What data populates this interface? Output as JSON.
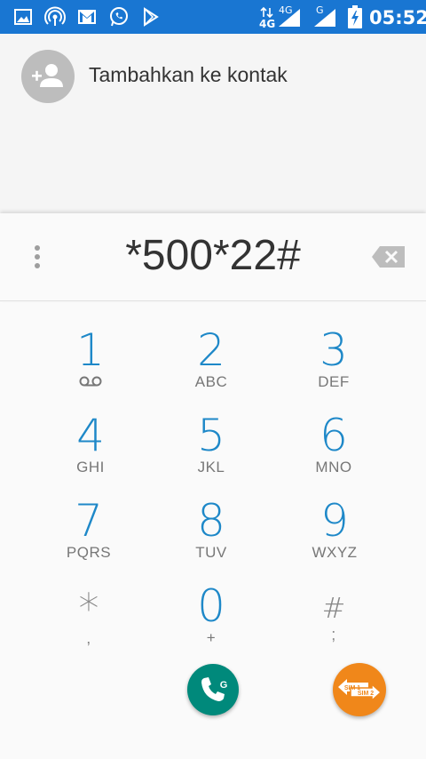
{
  "status_bar": {
    "time": "05:52",
    "network_1": "4G",
    "network_1_type": "4G",
    "network_2": "G",
    "icons": [
      "gallery-icon",
      "hotspot-icon",
      "gmail-icon",
      "whatsapp-icon",
      "play-store-icon",
      "data-arrows-icon",
      "signal-icon",
      "signal-icon",
      "battery-charging-icon"
    ]
  },
  "contact": {
    "add_label": "Tambahkan ke kontak"
  },
  "dialer": {
    "digits": "*500*22#",
    "keys": [
      {
        "num": "1",
        "sub": ""
      },
      {
        "num": "2",
        "sub": "ABC"
      },
      {
        "num": "3",
        "sub": "DEF"
      },
      {
        "num": "4",
        "sub": "GHI"
      },
      {
        "num": "5",
        "sub": "JKL"
      },
      {
        "num": "6",
        "sub": "MNO"
      },
      {
        "num": "7",
        "sub": "PQRS"
      },
      {
        "num": "8",
        "sub": "TUV"
      },
      {
        "num": "9",
        "sub": "WXYZ"
      },
      {
        "num": "*",
        "sub": ","
      },
      {
        "num": "0",
        "sub": "+"
      },
      {
        "num": "#",
        "sub": ";"
      }
    ],
    "call_badge": "G",
    "sim_labels": [
      "SIM 1",
      "SIM 2"
    ]
  },
  "colors": {
    "status_bar": "#1976d2",
    "key_digit": "#1e88c8",
    "call_button": "#00897b",
    "sim_button": "#f0871a"
  }
}
